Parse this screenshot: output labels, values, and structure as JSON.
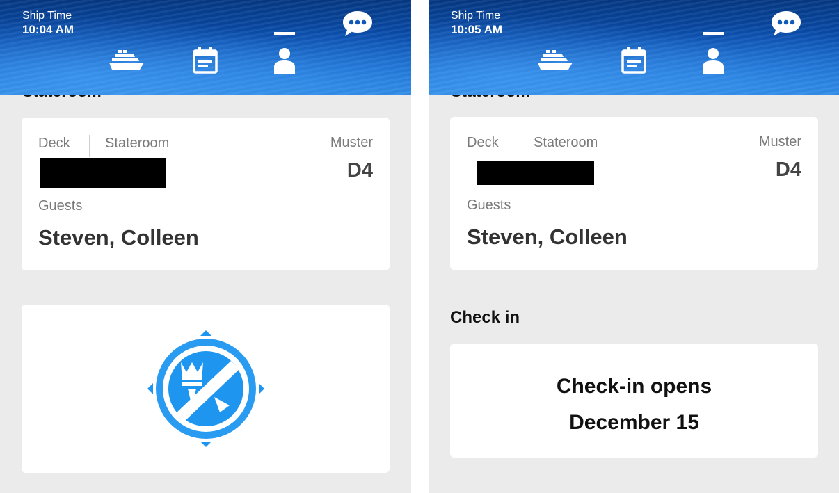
{
  "screens": [
    {
      "header": {
        "ship_time_label": "Ship Time",
        "ship_time_value": "10:04 AM",
        "icons": [
          "chat-bubble-icon",
          "cruise-ship-icon",
          "calendar-icon",
          "person-icon"
        ],
        "active_tab": "person-icon"
      },
      "clipped_section_title": "Stateroom",
      "stateroom_card": {
        "deck_label": "Deck",
        "stateroom_label": "Stateroom",
        "muster_label": "Muster",
        "muster_value": "D4",
        "guests_label": "Guests",
        "guests_value": "Steven, Colleen"
      },
      "logo_card": {
        "logo": "royal-caribbean-crown-anchor-logo",
        "logo_color": "#1e96f0"
      }
    },
    {
      "header": {
        "ship_time_label": "Ship Time",
        "ship_time_value": "10:05 AM",
        "icons": [
          "chat-bubble-icon",
          "cruise-ship-icon",
          "calendar-icon",
          "person-icon"
        ],
        "active_tab": "person-icon"
      },
      "clipped_section_title": "Stateroom",
      "stateroom_card": {
        "deck_label": "Deck",
        "stateroom_label": "Stateroom",
        "muster_label": "Muster",
        "muster_value": "D4",
        "guests_label": "Guests",
        "guests_value": "Steven, Colleen"
      },
      "checkin": {
        "title": "Check in",
        "line1": "Check-in opens",
        "line2": "December 15"
      }
    }
  ],
  "colors": {
    "background": "#ebebeb",
    "card": "#ffffff",
    "label_gray": "#7a7a7a",
    "header_blue": "#0a4fb0"
  }
}
